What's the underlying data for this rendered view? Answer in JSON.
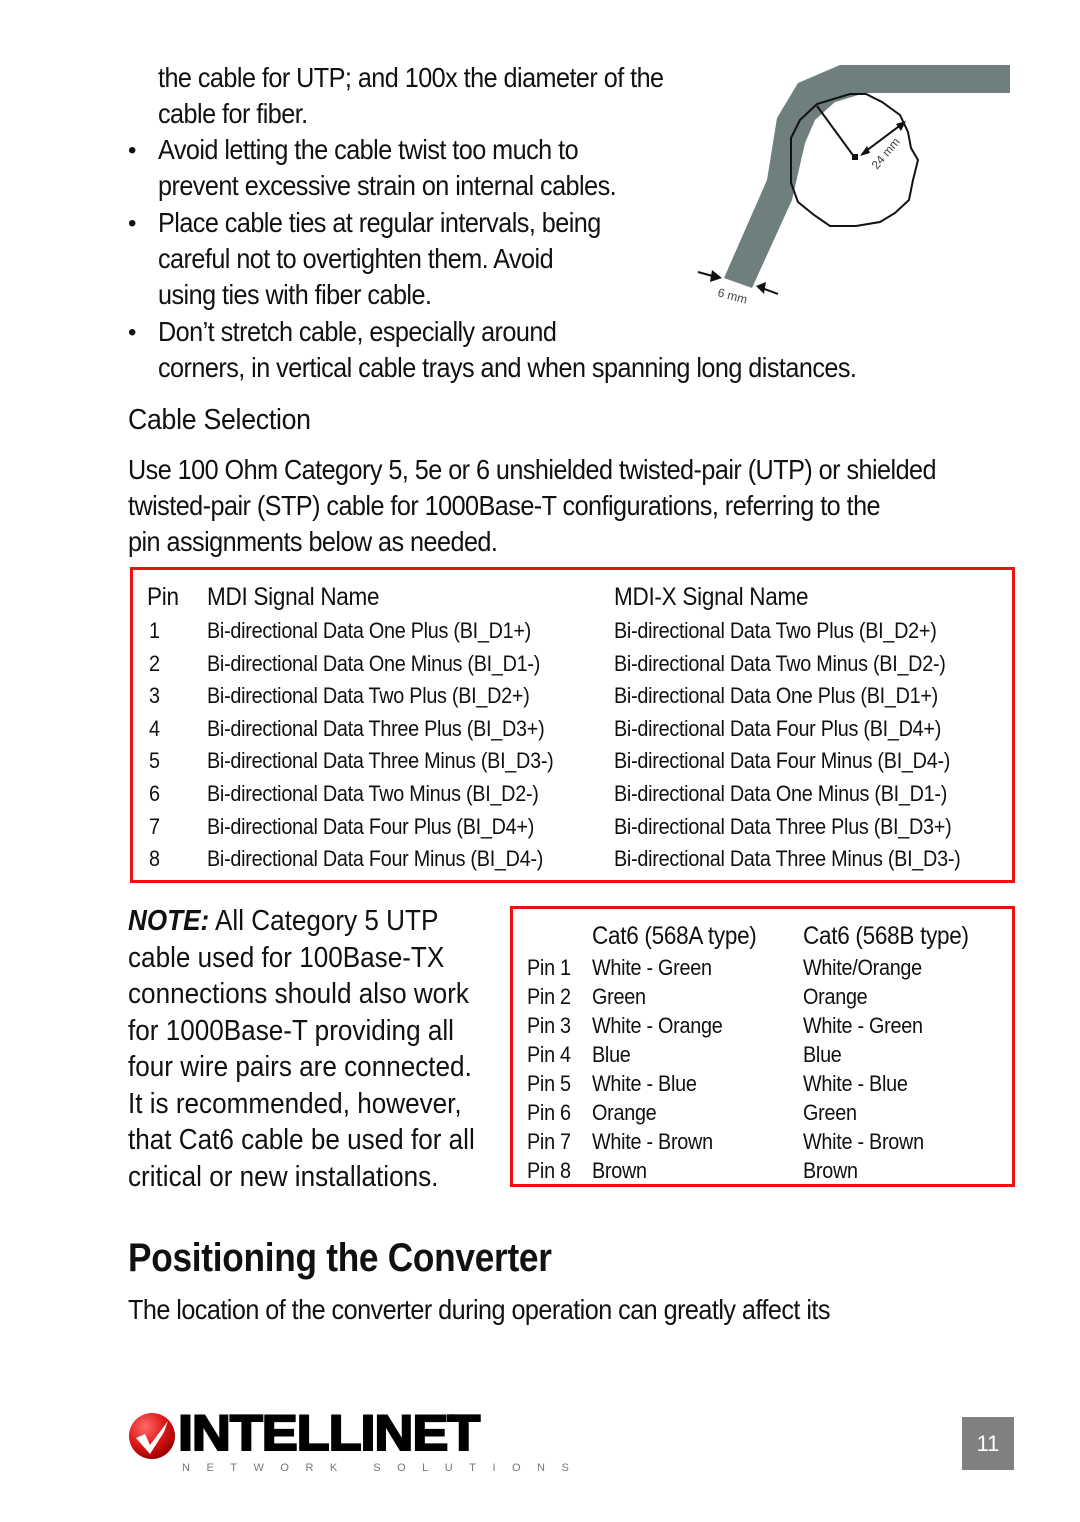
{
  "intro": {
    "lines": [
      "the cable for UTP; and 100x the diameter of the",
      "cable for fiber."
    ]
  },
  "bullets": [
    {
      "lines": [
        "Avoid letting the cable twist too much to",
        "prevent excessive strain on internal cables."
      ]
    },
    {
      "lines": [
        "Place cable ties at regular intervals, being",
        "careful not to overtighten them. Avoid",
        "using ties with fiber cable."
      ]
    },
    {
      "lines": [
        "Don’t stretch cable, especially around",
        "corners, in vertical cable trays and when spanning long distances."
      ]
    }
  ],
  "bullet_glyph": "•",
  "diagram": {
    "bend_radius_label": "24 mm",
    "cable_width_label": "6 mm",
    "cable_color": "#6f7f7d"
  },
  "cable_selection": {
    "heading": "Cable Selection",
    "paragraph_lines": [
      "Use 100 Ohm Category 5, 5e or 6 unshielded twisted-pair (UTP) or shielded",
      "twisted-pair (STP) cable for 1000Base-T configurations, referring to the",
      "pin assignments below as needed."
    ]
  },
  "signal_table": {
    "headers": {
      "pin": "Pin",
      "mdi": "MDI Signal Name",
      "mdix": "MDI-X Signal Name"
    },
    "rows": [
      {
        "pin": "1",
        "mdi": "Bi-directional Data One Plus (BI_D1+)",
        "mdix": "Bi-directional Data Two Plus (BI_D2+)"
      },
      {
        "pin": "2",
        "mdi": "Bi-directional Data One Minus (BI_D1-)",
        "mdix": "Bi-directional Data Two Minus (BI_D2-)"
      },
      {
        "pin": "3",
        "mdi": "Bi-directional Data Two Plus (BI_D2+)",
        "mdix": "Bi-directional Data One Plus (BI_D1+)"
      },
      {
        "pin": "4",
        "mdi": "Bi-directional Data Three Plus (BI_D3+)",
        "mdix": "Bi-directional Data Four Plus (BI_D4+)"
      },
      {
        "pin": "5",
        "mdi": "Bi-directional Data Three Minus (BI_D3-)",
        "mdix": "Bi-directional Data Four Minus (BI_D4-)"
      },
      {
        "pin": "6",
        "mdi": "Bi-directional Data Two Minus (BI_D2-)",
        "mdix": "Bi-directional Data One Minus (BI_D1-)"
      },
      {
        "pin": "7",
        "mdi": "Bi-directional Data Four Plus (BI_D4+)",
        "mdix": "Bi-directional Data Three Plus (BI_D3+)"
      },
      {
        "pin": "8",
        "mdi": "Bi-directional Data Four Minus (BI_D4-)",
        "mdix": "Bi-directional Data Three Minus (BI_D3-)"
      }
    ]
  },
  "note": {
    "label": "NOTE:",
    "lines": [
      " All Category 5 UTP",
      "cable used for 100Base-TX",
      "connections should also work",
      "for 1000Base-T providing all",
      "four wire pairs are connected.",
      "It is recommended, however,",
      "that Cat6 cable be used for all",
      "critical or new installations."
    ]
  },
  "wiring_table": {
    "headers": {
      "a": "Cat6 (568A type)",
      "b": "Cat6 (568B type)"
    },
    "rows": [
      {
        "pin": "Pin 1",
        "a": "White - Green",
        "b": "White/Orange"
      },
      {
        "pin": "Pin 2",
        "a": "Green",
        "b": "Orange"
      },
      {
        "pin": "Pin 3",
        "a": "White - Orange",
        "b": "White - Green"
      },
      {
        "pin": "Pin 4",
        "a": "Blue",
        "b": "Blue"
      },
      {
        "pin": "Pin 5",
        "a": "White - Blue",
        "b": "White - Blue"
      },
      {
        "pin": "Pin 6",
        "a": "Orange",
        "b": "Green"
      },
      {
        "pin": "Pin 7",
        "a": "White - Brown",
        "b": "White - Brown"
      },
      {
        "pin": "Pin 8",
        "a": "Brown",
        "b": "Brown"
      }
    ]
  },
  "positioning": {
    "heading": "Positioning the Converter",
    "paragraph": "The location of the converter during operation can greatly affect its"
  },
  "footer": {
    "brand": "INTELLINET",
    "tagline": "NETWORK SOLUTIONS",
    "trademark": "™",
    "page_number": "11",
    "accent_color": "#ee1111",
    "page_box_color": "#808080"
  }
}
